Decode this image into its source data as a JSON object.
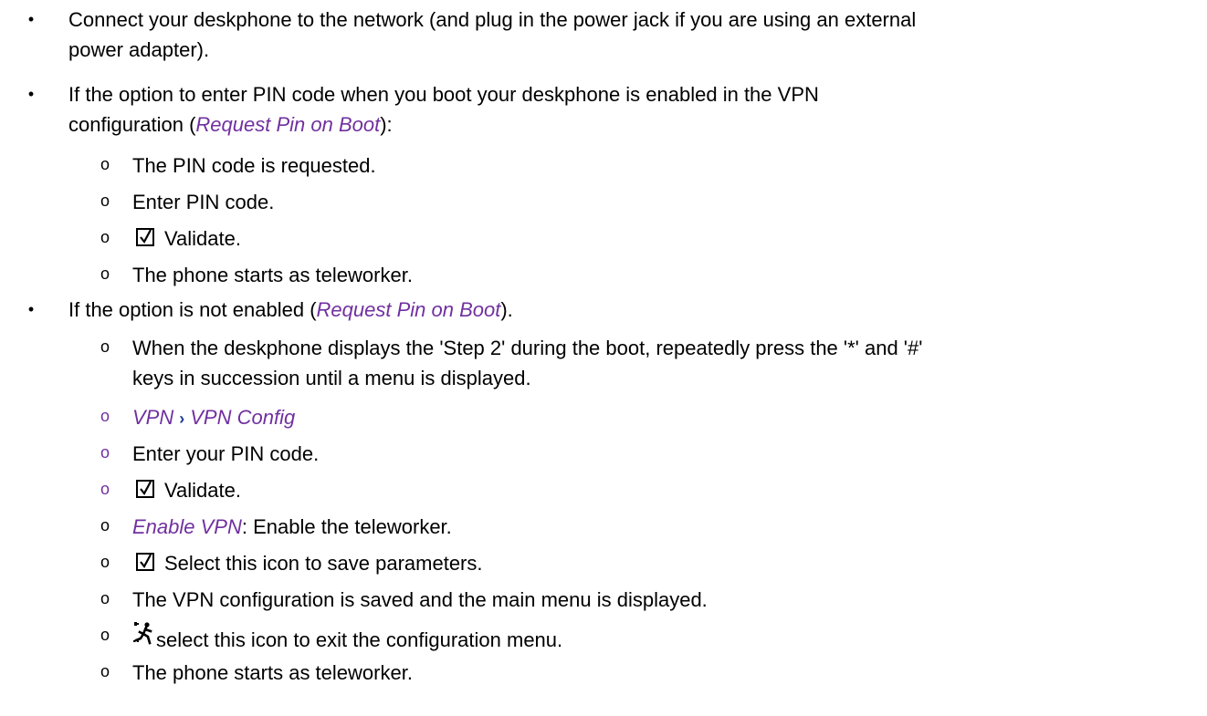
{
  "accent_color": "#7030a0",
  "separator_color": "#1f3a93",
  "bullets": [
    {
      "line1": "Connect your deskphone to the network (and plug in the power jack if you are using an external",
      "line2": "power adapter)."
    },
    {
      "line1": "If the option to enter PIN code when you boot your deskphone is enabled in the VPN",
      "line2_pre": "configuration (",
      "line2_link": "Request Pin on Boot",
      "line2_post": "):",
      "sub": [
        {
          "text": "The PIN code is requested."
        },
        {
          "text": "Enter PIN code."
        },
        {
          "icon": "checkbox-validate-icon",
          "text": "Validate."
        },
        {
          "text": "The phone starts as teleworker."
        }
      ]
    },
    {
      "pre": "If the option is not enabled (",
      "link": "Request Pin on Boot",
      "post": ").",
      "sub": [
        {
          "line1": "When the deskphone displays the 'Step 2' during the boot, repeatedly press the '*' and '#'",
          "line2": "keys in succession until a menu is displayed."
        },
        {
          "path": [
            "VPN",
            "VPN Config"
          ],
          "separator": "›"
        },
        {
          "text": "Enter your PIN code."
        },
        {
          "icon": "checkbox-validate-icon",
          "text": "Validate."
        },
        {
          "link": "Enable VPN",
          "text": ": Enable the teleworker."
        },
        {
          "icon": "checkbox-validate-icon",
          "text": "Select this icon to save parameters."
        },
        {
          "text": "The VPN configuration is saved and the main menu is displayed."
        },
        {
          "icon": "running-man-exit-icon",
          "text": "select this icon to exit the configuration menu."
        },
        {
          "text": "The phone starts as teleworker."
        }
      ]
    }
  ],
  "markers": {
    "bullet": "•",
    "sub": "o"
  }
}
